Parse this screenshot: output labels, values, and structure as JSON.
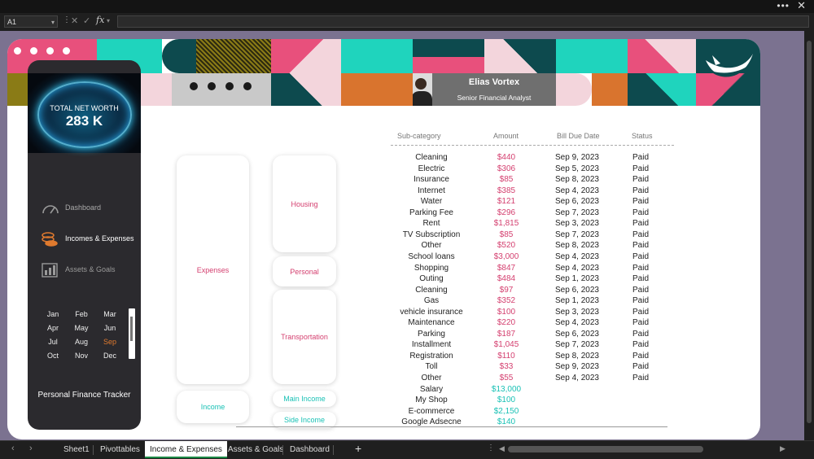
{
  "window": {
    "menu_dots": "•••",
    "close": "✕"
  },
  "formula_bar": {
    "name_box": "A1",
    "fx": "fx",
    "formula": ""
  },
  "banner": {
    "name": "Elias Vortex",
    "title": "Senior Financial Analyst"
  },
  "sidebar": {
    "net_worth_label": "TOTAL NET WORTH",
    "net_worth_value": "283 K",
    "nav": [
      {
        "label": "Dashboard",
        "icon": "gauge-icon",
        "active": false
      },
      {
        "label": "Incomes & Expenses",
        "icon": "coins-icon",
        "active": true
      },
      {
        "label": "Assets & Goals",
        "icon": "chart-icon",
        "active": false
      }
    ],
    "months": [
      "Jan",
      "Feb",
      "Mar",
      "Apr",
      "May",
      "Jun",
      "Jul",
      "Aug",
      "Sep",
      "Oct",
      "Nov",
      "Dec"
    ],
    "selected_month": "Sep",
    "footer": "Personal Finance Tracker"
  },
  "buttons": {
    "expenses": "Expenses",
    "housing": "Housing",
    "personal": "Personal",
    "transportation": "Transportation",
    "income": "Income",
    "main_income": "Main Income",
    "side_income": "Side Income"
  },
  "table": {
    "headers": [
      "Sub-category",
      "Amount",
      "Bill Due Date",
      "Status"
    ],
    "rows": [
      [
        "Cleaning",
        "$440",
        "Sep 9, 2023",
        "Paid"
      ],
      [
        "Electric",
        "$306",
        "Sep 5, 2023",
        "Paid"
      ],
      [
        "Insurance",
        "$85",
        "Sep 8, 2023",
        "Paid"
      ],
      [
        "Internet",
        "$385",
        "Sep 4, 2023",
        "Paid"
      ],
      [
        "Water",
        "$121",
        "Sep 6, 2023",
        "Paid"
      ],
      [
        "Parking Fee",
        "$296",
        "Sep 7, 2023",
        "Paid"
      ],
      [
        "Rent",
        "$1,815",
        "Sep 3, 2023",
        "Paid"
      ],
      [
        "TV Subscription",
        "$85",
        "Sep 7, 2023",
        "Paid"
      ],
      [
        "Other",
        "$520",
        "Sep 8, 2023",
        "Paid"
      ],
      [
        "School loans",
        "$3,000",
        "Sep 4, 2023",
        "Paid"
      ],
      [
        "Shopping",
        "$847",
        "Sep 4, 2023",
        "Paid"
      ],
      [
        "Outing",
        "$484",
        "Sep 1, 2023",
        "Paid"
      ],
      [
        "Cleaning",
        "$97",
        "Sep 6, 2023",
        "Paid"
      ],
      [
        "Gas",
        "$352",
        "Sep 1, 2023",
        "Paid"
      ],
      [
        "vehicle insurance",
        "$100",
        "Sep 3, 2023",
        "Paid"
      ],
      [
        "Maintenance",
        "$220",
        "Sep 4, 2023",
        "Paid"
      ],
      [
        "Parking",
        "$187",
        "Sep 6, 2023",
        "Paid"
      ],
      [
        "Installment",
        "$1,045",
        "Sep 7, 2023",
        "Paid"
      ],
      [
        "Registration",
        "$110",
        "Sep 8, 2023",
        "Paid"
      ],
      [
        "Toll",
        "$33",
        "Sep 9, 2023",
        "Paid"
      ],
      [
        "Other",
        "$55",
        "Sep 4, 2023",
        "Paid"
      ],
      [
        "Salary",
        "$13,000",
        "",
        ""
      ],
      [
        "My Shop",
        "$100",
        "",
        ""
      ],
      [
        "E-commerce",
        "$2,150",
        "",
        ""
      ],
      [
        "Google Adsecne",
        "$140",
        "",
        ""
      ]
    ],
    "expense_color": "#d43f6f",
    "income_color": "#19c1b5"
  },
  "sheet_tabs": [
    "Sheet1",
    "Pivottables",
    "Income & Expenses",
    "Assets & Goals",
    "Dashboard"
  ],
  "active_tab": "Income & Expenses",
  "colors": {
    "teal": "#1fd4bd",
    "pink": "#e8507c",
    "light_pink": "#f3d5dc",
    "dark_teal": "#0d4a4e",
    "orange": "#d9742e",
    "olive": "#8a7b16",
    "sidebar": "#2b2a2e",
    "sheet_bg": "#7b7290"
  }
}
